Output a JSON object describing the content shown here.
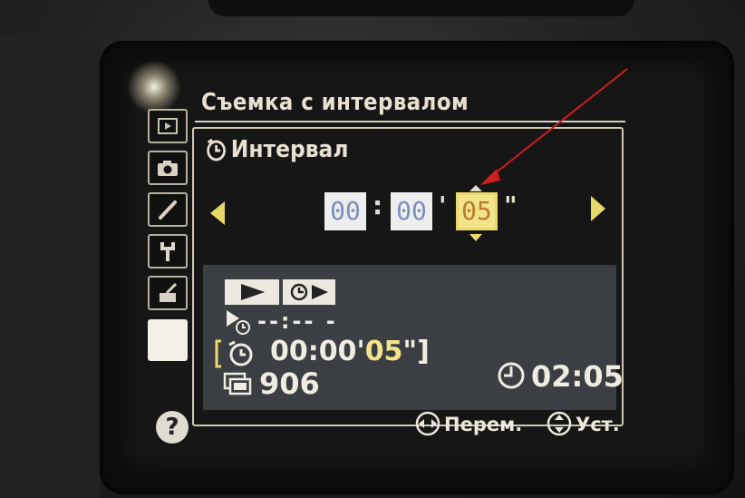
{
  "menu": {
    "title": "Съемка с интервалом",
    "tabs": [
      {
        "name": "playback-menu",
        "icon": "playback-icon"
      },
      {
        "name": "shooting-menu",
        "icon": "camera-icon"
      },
      {
        "name": "custom-settings",
        "icon": "pencil-icon"
      },
      {
        "name": "setup-menu",
        "icon": "wrench-icon"
      },
      {
        "name": "retouch-menu",
        "icon": "retouch-brush-icon"
      },
      {
        "name": "my-menu",
        "icon": "my-menu-icon",
        "active": true
      }
    ],
    "help_label": "?"
  },
  "interval": {
    "label": "Интервал",
    "hours": "00",
    "minutes": "00",
    "seconds": "05",
    "sep_colon": ":",
    "sep_minutes": "'",
    "sep_seconds": "\"",
    "selected_field": "seconds"
  },
  "summary": {
    "start_time": "--:-- -",
    "interval_prefix": "00:00'",
    "interval_value": "05",
    "interval_suffix": "\"]",
    "shots_remaining": "906",
    "clock": "02:05"
  },
  "footer": {
    "move_label": "Перем.",
    "set_label": "Уст."
  },
  "colors": {
    "highlight": "#ebd86c",
    "accent_text": "#f2e48a",
    "annotation_arrow": "#d01f1f"
  }
}
